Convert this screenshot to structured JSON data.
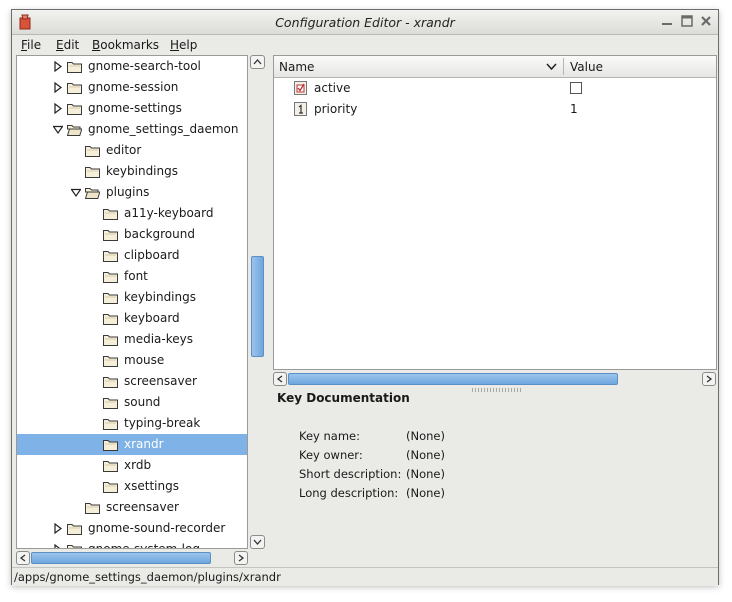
{
  "window": {
    "title": "Configuration Editor - xrandr"
  },
  "menubar": {
    "items": [
      {
        "label": "File",
        "mnemonic": "F",
        "rest": "ile"
      },
      {
        "label": "Edit",
        "mnemonic": "E",
        "rest": "dit"
      },
      {
        "label": "Bookmarks",
        "mnemonic": "B",
        "rest": "ookmarks"
      },
      {
        "label": "Help",
        "mnemonic": "H",
        "rest": "elp"
      }
    ]
  },
  "tree": {
    "items": [
      {
        "label": "gnome-search-tool",
        "depth": 2,
        "expander": "collapsed",
        "open": false,
        "selected": false
      },
      {
        "label": "gnome-session",
        "depth": 2,
        "expander": "collapsed",
        "open": false,
        "selected": false
      },
      {
        "label": "gnome-settings",
        "depth": 2,
        "expander": "collapsed",
        "open": false,
        "selected": false
      },
      {
        "label": "gnome_settings_daemon",
        "depth": 2,
        "expander": "expanded",
        "open": true,
        "selected": false
      },
      {
        "label": "editor",
        "depth": 3,
        "expander": "none",
        "open": false,
        "selected": false
      },
      {
        "label": "keybindings",
        "depth": 3,
        "expander": "none",
        "open": false,
        "selected": false
      },
      {
        "label": "plugins",
        "depth": 3,
        "expander": "expanded",
        "open": true,
        "selected": false
      },
      {
        "label": "a11y-keyboard",
        "depth": 4,
        "expander": "none",
        "open": false,
        "selected": false
      },
      {
        "label": "background",
        "depth": 4,
        "expander": "none",
        "open": false,
        "selected": false
      },
      {
        "label": "clipboard",
        "depth": 4,
        "expander": "none",
        "open": false,
        "selected": false
      },
      {
        "label": "font",
        "depth": 4,
        "expander": "none",
        "open": false,
        "selected": false
      },
      {
        "label": "keybindings",
        "depth": 4,
        "expander": "none",
        "open": false,
        "selected": false
      },
      {
        "label": "keyboard",
        "depth": 4,
        "expander": "none",
        "open": false,
        "selected": false
      },
      {
        "label": "media-keys",
        "depth": 4,
        "expander": "none",
        "open": false,
        "selected": false
      },
      {
        "label": "mouse",
        "depth": 4,
        "expander": "none",
        "open": false,
        "selected": false
      },
      {
        "label": "screensaver",
        "depth": 4,
        "expander": "none",
        "open": false,
        "selected": false
      },
      {
        "label": "sound",
        "depth": 4,
        "expander": "none",
        "open": false,
        "selected": false
      },
      {
        "label": "typing-break",
        "depth": 4,
        "expander": "none",
        "open": false,
        "selected": false
      },
      {
        "label": "xrandr",
        "depth": 4,
        "expander": "none",
        "open": false,
        "selected": true
      },
      {
        "label": "xrdb",
        "depth": 4,
        "expander": "none",
        "open": false,
        "selected": false
      },
      {
        "label": "xsettings",
        "depth": 4,
        "expander": "none",
        "open": false,
        "selected": false
      },
      {
        "label": "screensaver",
        "depth": 3,
        "expander": "none",
        "open": false,
        "selected": false
      },
      {
        "label": "gnome-sound-recorder",
        "depth": 2,
        "expander": "collapsed",
        "open": false,
        "selected": false
      },
      {
        "label": "gnome-system-log",
        "depth": 2,
        "expander": "collapsed",
        "open": false,
        "selected": false
      }
    ]
  },
  "keys_list": {
    "columns": {
      "name": "Name",
      "value": "Value"
    },
    "rows": [
      {
        "name": "active",
        "type": "bool",
        "value": "",
        "checked": false,
        "icon": "bool-key-icon"
      },
      {
        "name": "priority",
        "type": "int",
        "value": "1",
        "icon": "int-key-icon"
      }
    ]
  },
  "documentation": {
    "title": "Key Documentation",
    "fields": [
      {
        "label": "Key name:",
        "value": "(None)"
      },
      {
        "label": "Key owner:",
        "value": "(None)"
      },
      {
        "label": "Short description:",
        "value": "(None)"
      },
      {
        "label": "Long description:",
        "value": "(None)"
      }
    ]
  },
  "statusbar": {
    "path": "/apps/gnome_settings_daemon/plugins/xrandr"
  },
  "colors": {
    "selection": "#7fb2e6",
    "scroll_thumb": "#6ea6df",
    "window_bg": "#eaeae7"
  }
}
